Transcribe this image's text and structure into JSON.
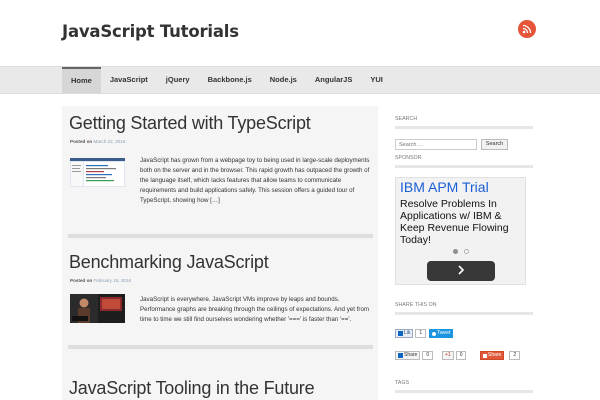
{
  "site": {
    "title": "JavaScript Tutorials",
    "rss_icon": "rss-icon"
  },
  "nav": {
    "items": [
      {
        "label": "Home",
        "active": true
      },
      {
        "label": "JavaScript"
      },
      {
        "label": "jQuery"
      },
      {
        "label": "Backbone.js"
      },
      {
        "label": "Node.js"
      },
      {
        "label": "AngularJS"
      },
      {
        "label": "YUI"
      }
    ]
  },
  "posts": [
    {
      "title": "Getting Started with TypeScript",
      "meta_prefix": "Posted on",
      "date": "March 22, 2016",
      "excerpt": "JavaScript has grown from a webpage toy to being used in large-scale deployments both on the server and in the browser. This rapid growth has outpaced the growth of the language itself, which lacks features that allow teams to communicate requirements and build applications safely. This session offers a guided tour of TypeScript, showing how […]"
    },
    {
      "title": "Benchmarking JavaScript",
      "meta_prefix": "Posted on",
      "date": "February 15, 2016",
      "excerpt": "JavaScript is everywhere. JavaScript VMs improve by leaps and bounds. Performance graphs are breaking through the ceilings of expectations. And yet from time to time we still find ourselves wondering whether '===' is faster than '=='."
    },
    {
      "title": "JavaScript Tooling in the Future"
    }
  ],
  "sidebar": {
    "search_title": "SEARCH",
    "search_placeholder": "Search …",
    "search_button": "Search",
    "sponsor_title": "SPONSOR",
    "ad": {
      "headline": "IBM APM Trial",
      "body": "Resolve Problems In Applications w/ IBM & Keep Revenue Flowing Today!"
    },
    "share_title": "SHARE THIS ON",
    "share": {
      "linkedin_label": "Lik",
      "linkedin_count": "1",
      "tweet_label": "Tweet",
      "share_label": "Share",
      "share_count": "0",
      "gplus_label": "+1",
      "gplus_count": "0",
      "stumble_label": "Share",
      "stumble_count": "2"
    },
    "tags_title": "TAGS"
  },
  "colors": {
    "accent_rss": "#e6553a",
    "ad_blue": "#1a5fd6",
    "link_date": "#8aa0b8"
  }
}
